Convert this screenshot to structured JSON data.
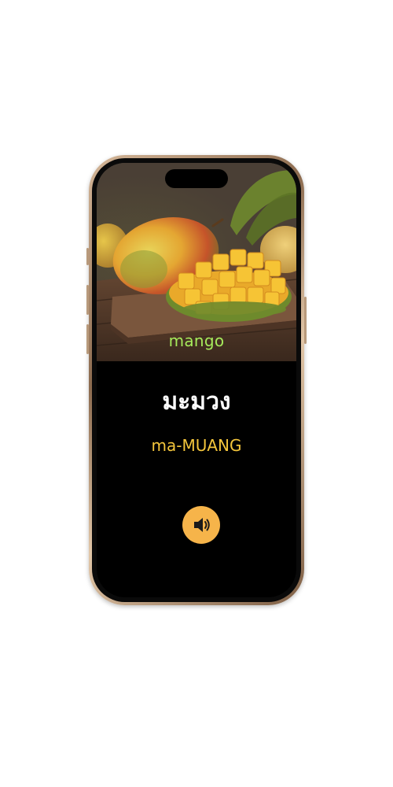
{
  "flashcard": {
    "image_subject": "mango",
    "english_word": "mango",
    "thai_word": "มะมวง",
    "romanization": "ma-MUANG",
    "audio_icon": "speaker-icon"
  },
  "colors": {
    "english_word": "#a6ea5b",
    "romanization": "#f4c63c",
    "audio_button": "#f6b44a",
    "screen_background": "#000000"
  }
}
